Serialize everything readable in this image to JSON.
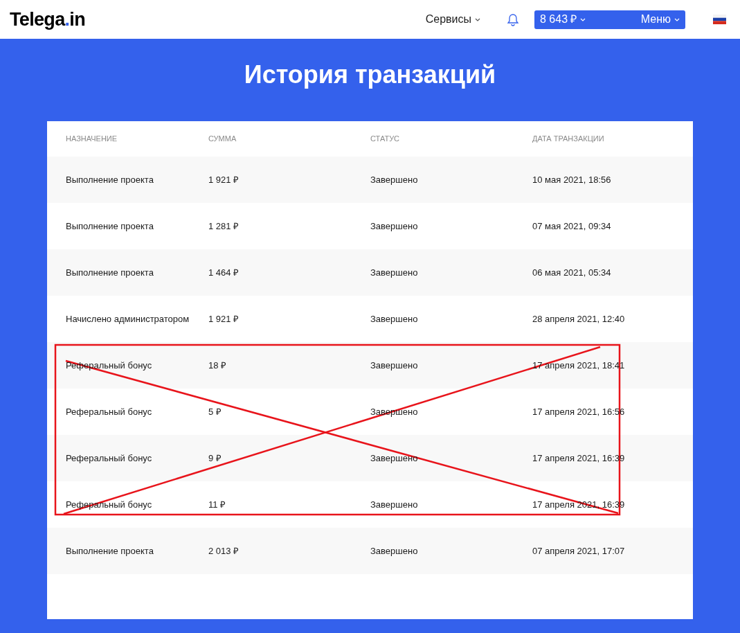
{
  "logo": {
    "name": "Telega",
    "dot": ".",
    "suffix": "in"
  },
  "nav": {
    "services": "Сервисы",
    "balance": "8 643 ₽",
    "menu": "Меню"
  },
  "page_title": "История транзакций",
  "table": {
    "columns": [
      "НАЗНАЧЕНИЕ",
      "СУММА",
      "СТАТУС",
      "ДАТА ТРАНЗАКЦИИ"
    ],
    "rows": [
      {
        "purpose": "Выполнение проекта",
        "amount": "1 921 ₽",
        "status": "Завершено",
        "date": "10 мая 2021, 18:56",
        "crossed_out": false
      },
      {
        "purpose": "Выполнение проекта",
        "amount": "1 281 ₽",
        "status": "Завершено",
        "date": "07 мая 2021, 09:34",
        "crossed_out": false
      },
      {
        "purpose": "Выполнение проекта",
        "amount": "1 464 ₽",
        "status": "Завершено",
        "date": "06 мая 2021, 05:34",
        "crossed_out": false
      },
      {
        "purpose": "Начислено администратором",
        "amount": "1 921 ₽",
        "status": "Завершено",
        "date": "28 апреля 2021, 12:40",
        "crossed_out": false
      },
      {
        "purpose": "Реферальный бонус",
        "amount": "18 ₽",
        "status": "Завершено",
        "date": "17 апреля 2021, 18:41",
        "crossed_out": true
      },
      {
        "purpose": "Реферальный бонус",
        "amount": "5 ₽",
        "status": "Завершено",
        "date": "17 апреля 2021, 16:56",
        "crossed_out": true
      },
      {
        "purpose": "Реферальный бонус",
        "amount": "9 ₽",
        "status": "Завершено",
        "date": "17 апреля 2021, 16:39",
        "crossed_out": true
      },
      {
        "purpose": "Реферальный бонус",
        "amount": "11 ₽",
        "status": "Завершено",
        "date": "17 апреля 2021, 16:39",
        "crossed_out": true
      },
      {
        "purpose": "Выполнение проекта",
        "amount": "2 013 ₽",
        "status": "Завершено",
        "date": "07 апреля 2021, 17:07",
        "crossed_out": false
      }
    ]
  }
}
